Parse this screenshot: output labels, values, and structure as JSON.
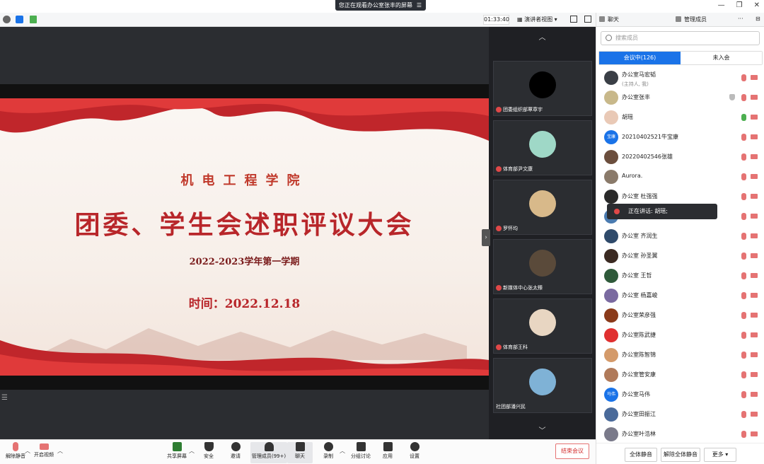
{
  "banner": {
    "text": "您正在观看办公室张丰的屏幕"
  },
  "top_toolbar": {
    "timer": "01:33:40",
    "presenter_view": "演讲者视图"
  },
  "slide": {
    "college": "机电工程学院",
    "title": "团委、学生会述职评议大会",
    "term": "2022-2023学年第一学期",
    "time": "时间：2022.12.18"
  },
  "thumbnails": [
    {
      "name": "团委组织部覃章宇",
      "color": "#000000"
    },
    {
      "name": "体育部尹文康",
      "color": "#9fd8c7"
    },
    {
      "name": "罗怀均",
      "color": "#d8b98a"
    },
    {
      "name": "新媒体中心张太臻",
      "color": "#5a4a3a"
    },
    {
      "name": "体育部王科",
      "color": "#e8d6c2"
    },
    {
      "name": "社团部潘兴民",
      "color": "#7fb2d6"
    }
  ],
  "panel": {
    "tab_chat": "聊天",
    "tab_members": "管理成员",
    "search_placeholder": "搜索成员",
    "seg_in_meeting": "会议中(126)",
    "seg_not_joined": "未入会",
    "members": [
      {
        "name": "办公室马宏韬",
        "sub": "(主持人, 我)",
        "avatar": "",
        "color": "#3a3f46",
        "mic": "off"
      },
      {
        "name": "办公室张丰",
        "sub": "",
        "avatar": "",
        "color": "#c8b88a",
        "mic": "off",
        "shield": true
      },
      {
        "name": "胡瑶",
        "sub": "",
        "avatar": "",
        "color": "#e9c9b6",
        "mic": "on"
      },
      {
        "name": "20210402521牛宝康",
        "sub": "",
        "avatar": "宝康",
        "color": "#1a73e8",
        "mic": "off"
      },
      {
        "name": "20220402546张雄",
        "sub": "",
        "avatar": "",
        "color": "#6b4e3d",
        "mic": "off"
      },
      {
        "name": "Aurora.",
        "sub": "",
        "avatar": "",
        "color": "#8a7a6a",
        "mic": "off"
      },
      {
        "name": "办公室 杜强强",
        "sub": "",
        "avatar": "",
        "color": "#2a2a2a",
        "mic": "off"
      },
      {
        "name": "",
        "sub": "",
        "avatar": "",
        "color": "#4a7bb0",
        "mic": "off"
      },
      {
        "name": "办公室 齐润生",
        "sub": "",
        "avatar": "",
        "color": "#2f4a6a",
        "mic": "off"
      },
      {
        "name": "办公室 孙圣翼",
        "sub": "",
        "avatar": "",
        "color": "#3b2a22",
        "mic": "off"
      },
      {
        "name": "办公室 王哲",
        "sub": "",
        "avatar": "",
        "color": "#2f5a3a",
        "mic": "off"
      },
      {
        "name": "办公室 杨嘉峻",
        "sub": "",
        "avatar": "",
        "color": "#7a6aa0",
        "mic": "off"
      },
      {
        "name": "办公室荣彦强",
        "sub": "",
        "avatar": "",
        "color": "#8a3a1a",
        "mic": "off"
      },
      {
        "name": "办公室陈武捷",
        "sub": "",
        "avatar": "",
        "color": "#e03030",
        "mic": "off"
      },
      {
        "name": "办公室陈智锦",
        "sub": "",
        "avatar": "",
        "color": "#d49a6a",
        "mic": "off"
      },
      {
        "name": "办公室管安康",
        "sub": "",
        "avatar": "",
        "color": "#b07a5a",
        "mic": "off"
      },
      {
        "name": "办公室马伟",
        "sub": "",
        "avatar": "马伟",
        "color": "#1a73e8",
        "mic": "off"
      },
      {
        "name": "办公室田振江",
        "sub": "",
        "avatar": "",
        "color": "#4a6a9a",
        "mic": "off"
      },
      {
        "name": "办公室叶浩林",
        "sub": "",
        "avatar": "",
        "color": "#7a7a8a",
        "mic": "off"
      }
    ],
    "speaking": "正在讲话: 胡瑶;",
    "btn_mute_all": "全体静音",
    "btn_unmute_all": "解除全体静音",
    "btn_more": "更多"
  },
  "bottom": {
    "unmute": "解除静音",
    "start_video": "开启视频",
    "share": "共享屏幕",
    "security": "安全",
    "invite": "邀请",
    "manage": "管理成员(99+)",
    "chat": "聊天",
    "record": "录制",
    "breakout": "分组讨论",
    "apps": "应用",
    "settings": "设置",
    "end": "结束会议"
  }
}
